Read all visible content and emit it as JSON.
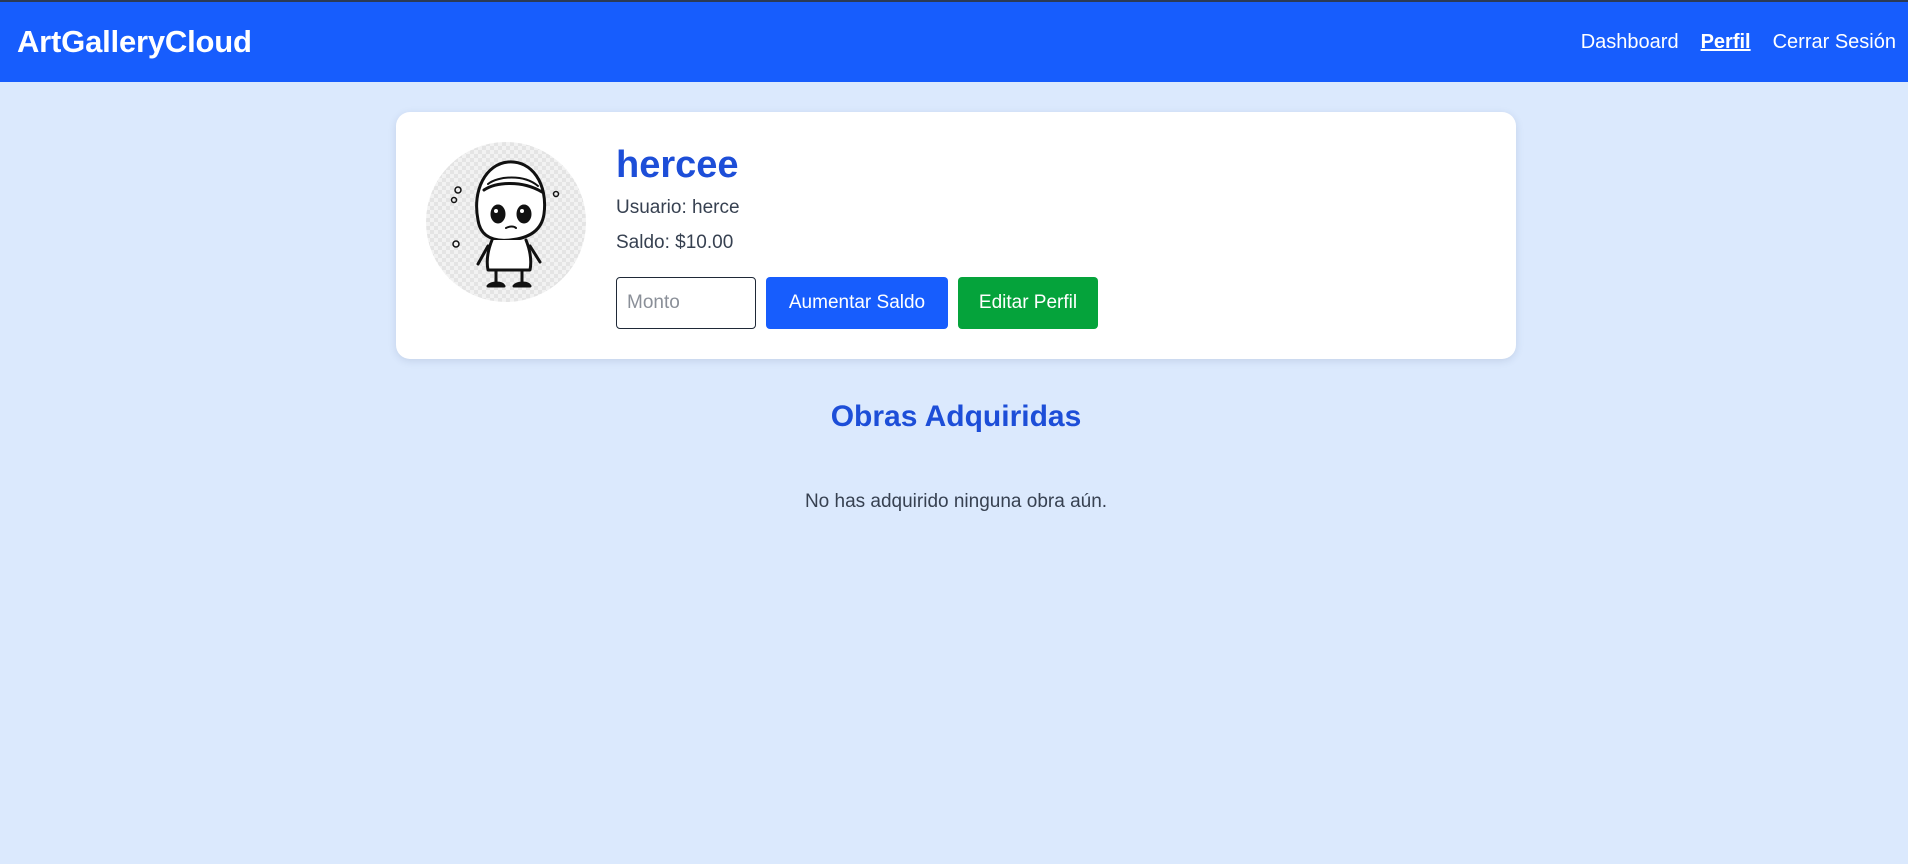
{
  "app": {
    "brand": "ArtGalleryCloud"
  },
  "nav": {
    "items": [
      {
        "label": "Dashboard",
        "active": false
      },
      {
        "label": "Perfil",
        "active": true
      },
      {
        "label": "Cerrar Sesión",
        "active": false
      }
    ]
  },
  "profile": {
    "display_name": "hercee",
    "username_line": "Usuario: herce",
    "balance_line": "Saldo: $10.00",
    "avatar_icon": "cartoon-boy-avatar-icon",
    "amount_placeholder": "Monto",
    "amount_value": "",
    "add_balance_label": "Aumentar Saldo",
    "edit_profile_label": "Editar Perfil"
  },
  "acquired": {
    "title": "Obras Adquiridas",
    "empty_message": "No has adquirido ninguna obra aún."
  },
  "colors": {
    "primary": "#175dfd",
    "success": "#05a33b",
    "heading": "#1d4ed8",
    "background": "#dbe9fd"
  }
}
